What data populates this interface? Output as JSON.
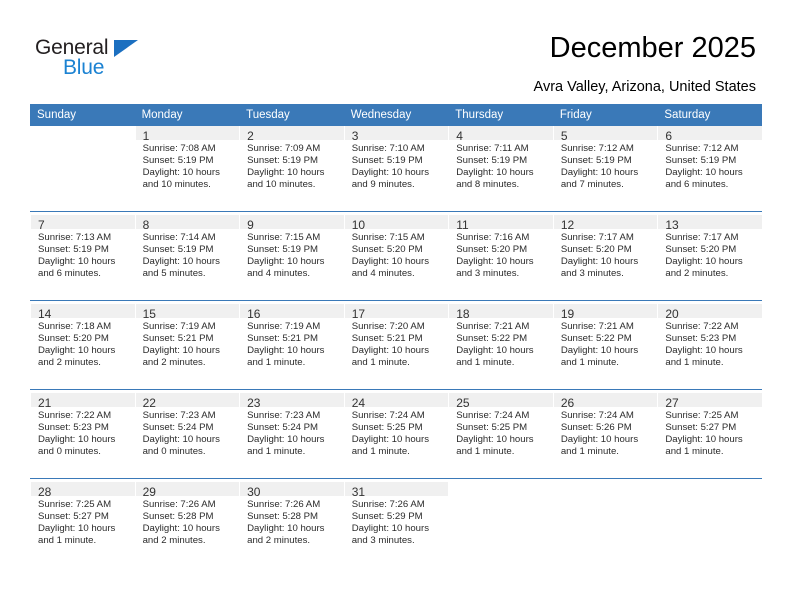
{
  "brand": {
    "name_part1": "General",
    "name_part2": "Blue",
    "triangle_color": "#1b6fc0",
    "blue_color": "#1b82d2"
  },
  "header": {
    "title": "December 2025",
    "location": "Avra Valley, Arizona, United States",
    "accent_color": "#3a79b8"
  },
  "calendar": {
    "weekday_headers": [
      "Sunday",
      "Monday",
      "Tuesday",
      "Wednesday",
      "Thursday",
      "Friday",
      "Saturday"
    ],
    "labels": {
      "sunrise": "Sunrise:",
      "sunset": "Sunset:",
      "daylight": "Daylight:"
    },
    "weeks": [
      [
        {
          "day": "",
          "sunrise": "",
          "sunset": "",
          "daylight_line1": "",
          "daylight_line2": ""
        },
        {
          "day": "1",
          "sunrise": "Sunrise: 7:08 AM",
          "sunset": "Sunset: 5:19 PM",
          "daylight_line1": "Daylight: 10 hours",
          "daylight_line2": "and 10 minutes."
        },
        {
          "day": "2",
          "sunrise": "Sunrise: 7:09 AM",
          "sunset": "Sunset: 5:19 PM",
          "daylight_line1": "Daylight: 10 hours",
          "daylight_line2": "and 10 minutes."
        },
        {
          "day": "3",
          "sunrise": "Sunrise: 7:10 AM",
          "sunset": "Sunset: 5:19 PM",
          "daylight_line1": "Daylight: 10 hours",
          "daylight_line2": "and 9 minutes."
        },
        {
          "day": "4",
          "sunrise": "Sunrise: 7:11 AM",
          "sunset": "Sunset: 5:19 PM",
          "daylight_line1": "Daylight: 10 hours",
          "daylight_line2": "and 8 minutes."
        },
        {
          "day": "5",
          "sunrise": "Sunrise: 7:12 AM",
          "sunset": "Sunset: 5:19 PM",
          "daylight_line1": "Daylight: 10 hours",
          "daylight_line2": "and 7 minutes."
        },
        {
          "day": "6",
          "sunrise": "Sunrise: 7:12 AM",
          "sunset": "Sunset: 5:19 PM",
          "daylight_line1": "Daylight: 10 hours",
          "daylight_line2": "and 6 minutes."
        }
      ],
      [
        {
          "day": "7",
          "sunrise": "Sunrise: 7:13 AM",
          "sunset": "Sunset: 5:19 PM",
          "daylight_line1": "Daylight: 10 hours",
          "daylight_line2": "and 6 minutes."
        },
        {
          "day": "8",
          "sunrise": "Sunrise: 7:14 AM",
          "sunset": "Sunset: 5:19 PM",
          "daylight_line1": "Daylight: 10 hours",
          "daylight_line2": "and 5 minutes."
        },
        {
          "day": "9",
          "sunrise": "Sunrise: 7:15 AM",
          "sunset": "Sunset: 5:19 PM",
          "daylight_line1": "Daylight: 10 hours",
          "daylight_line2": "and 4 minutes."
        },
        {
          "day": "10",
          "sunrise": "Sunrise: 7:15 AM",
          "sunset": "Sunset: 5:20 PM",
          "daylight_line1": "Daylight: 10 hours",
          "daylight_line2": "and 4 minutes."
        },
        {
          "day": "11",
          "sunrise": "Sunrise: 7:16 AM",
          "sunset": "Sunset: 5:20 PM",
          "daylight_line1": "Daylight: 10 hours",
          "daylight_line2": "and 3 minutes."
        },
        {
          "day": "12",
          "sunrise": "Sunrise: 7:17 AM",
          "sunset": "Sunset: 5:20 PM",
          "daylight_line1": "Daylight: 10 hours",
          "daylight_line2": "and 3 minutes."
        },
        {
          "day": "13",
          "sunrise": "Sunrise: 7:17 AM",
          "sunset": "Sunset: 5:20 PM",
          "daylight_line1": "Daylight: 10 hours",
          "daylight_line2": "and 2 minutes."
        }
      ],
      [
        {
          "day": "14",
          "sunrise": "Sunrise: 7:18 AM",
          "sunset": "Sunset: 5:20 PM",
          "daylight_line1": "Daylight: 10 hours",
          "daylight_line2": "and 2 minutes."
        },
        {
          "day": "15",
          "sunrise": "Sunrise: 7:19 AM",
          "sunset": "Sunset: 5:21 PM",
          "daylight_line1": "Daylight: 10 hours",
          "daylight_line2": "and 2 minutes."
        },
        {
          "day": "16",
          "sunrise": "Sunrise: 7:19 AM",
          "sunset": "Sunset: 5:21 PM",
          "daylight_line1": "Daylight: 10 hours",
          "daylight_line2": "and 1 minute."
        },
        {
          "day": "17",
          "sunrise": "Sunrise: 7:20 AM",
          "sunset": "Sunset: 5:21 PM",
          "daylight_line1": "Daylight: 10 hours",
          "daylight_line2": "and 1 minute."
        },
        {
          "day": "18",
          "sunrise": "Sunrise: 7:21 AM",
          "sunset": "Sunset: 5:22 PM",
          "daylight_line1": "Daylight: 10 hours",
          "daylight_line2": "and 1 minute."
        },
        {
          "day": "19",
          "sunrise": "Sunrise: 7:21 AM",
          "sunset": "Sunset: 5:22 PM",
          "daylight_line1": "Daylight: 10 hours",
          "daylight_line2": "and 1 minute."
        },
        {
          "day": "20",
          "sunrise": "Sunrise: 7:22 AM",
          "sunset": "Sunset: 5:23 PM",
          "daylight_line1": "Daylight: 10 hours",
          "daylight_line2": "and 1 minute."
        }
      ],
      [
        {
          "day": "21",
          "sunrise": "Sunrise: 7:22 AM",
          "sunset": "Sunset: 5:23 PM",
          "daylight_line1": "Daylight: 10 hours",
          "daylight_line2": "and 0 minutes."
        },
        {
          "day": "22",
          "sunrise": "Sunrise: 7:23 AM",
          "sunset": "Sunset: 5:24 PM",
          "daylight_line1": "Daylight: 10 hours",
          "daylight_line2": "and 0 minutes."
        },
        {
          "day": "23",
          "sunrise": "Sunrise: 7:23 AM",
          "sunset": "Sunset: 5:24 PM",
          "daylight_line1": "Daylight: 10 hours",
          "daylight_line2": "and 1 minute."
        },
        {
          "day": "24",
          "sunrise": "Sunrise: 7:24 AM",
          "sunset": "Sunset: 5:25 PM",
          "daylight_line1": "Daylight: 10 hours",
          "daylight_line2": "and 1 minute."
        },
        {
          "day": "25",
          "sunrise": "Sunrise: 7:24 AM",
          "sunset": "Sunset: 5:25 PM",
          "daylight_line1": "Daylight: 10 hours",
          "daylight_line2": "and 1 minute."
        },
        {
          "day": "26",
          "sunrise": "Sunrise: 7:24 AM",
          "sunset": "Sunset: 5:26 PM",
          "daylight_line1": "Daylight: 10 hours",
          "daylight_line2": "and 1 minute."
        },
        {
          "day": "27",
          "sunrise": "Sunrise: 7:25 AM",
          "sunset": "Sunset: 5:27 PM",
          "daylight_line1": "Daylight: 10 hours",
          "daylight_line2": "and 1 minute."
        }
      ],
      [
        {
          "day": "28",
          "sunrise": "Sunrise: 7:25 AM",
          "sunset": "Sunset: 5:27 PM",
          "daylight_line1": "Daylight: 10 hours",
          "daylight_line2": "and 1 minute."
        },
        {
          "day": "29",
          "sunrise": "Sunrise: 7:26 AM",
          "sunset": "Sunset: 5:28 PM",
          "daylight_line1": "Daylight: 10 hours",
          "daylight_line2": "and 2 minutes."
        },
        {
          "day": "30",
          "sunrise": "Sunrise: 7:26 AM",
          "sunset": "Sunset: 5:28 PM",
          "daylight_line1": "Daylight: 10 hours",
          "daylight_line2": "and 2 minutes."
        },
        {
          "day": "31",
          "sunrise": "Sunrise: 7:26 AM",
          "sunset": "Sunset: 5:29 PM",
          "daylight_line1": "Daylight: 10 hours",
          "daylight_line2": "and 3 minutes."
        },
        {
          "day": "",
          "sunrise": "",
          "sunset": "",
          "daylight_line1": "",
          "daylight_line2": ""
        },
        {
          "day": "",
          "sunrise": "",
          "sunset": "",
          "daylight_line1": "",
          "daylight_line2": ""
        },
        {
          "day": "",
          "sunrise": "",
          "sunset": "",
          "daylight_line1": "",
          "daylight_line2": ""
        }
      ]
    ]
  }
}
